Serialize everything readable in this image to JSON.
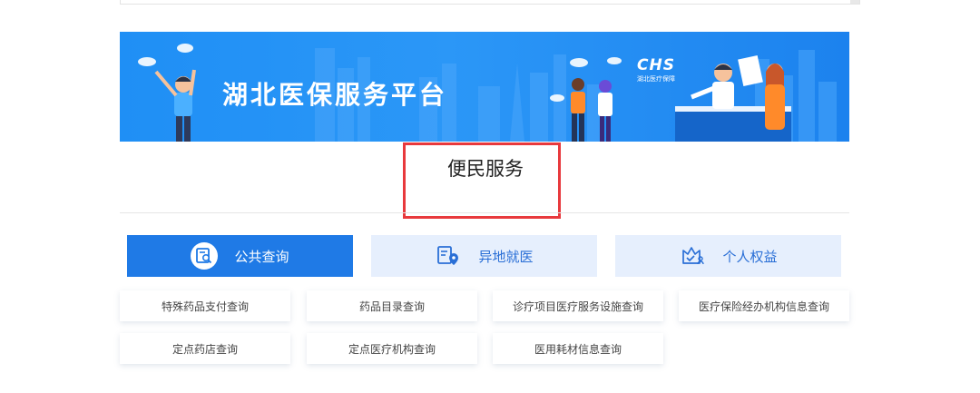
{
  "banner": {
    "title": "湖北医保服务平台",
    "logo_big": "CHS",
    "logo_small": "湖北医疗保障",
    "colors": {
      "sky": "#2a94f6",
      "building": "#5cb0ff"
    }
  },
  "section": {
    "title": "便民服务",
    "highlight_color": "#e8393d"
  },
  "tabs": [
    {
      "label": "公共查询",
      "icon": "search-document-icon",
      "active": true
    },
    {
      "label": "异地就医",
      "icon": "location-document-icon",
      "active": false
    },
    {
      "label": "个人权益",
      "icon": "crown-user-icon",
      "active": false
    }
  ],
  "services": [
    {
      "label": "特殊药品支付查询"
    },
    {
      "label": "药品目录查询"
    },
    {
      "label": "诊疗项目医疗服务设施查询"
    },
    {
      "label": "医疗保险经办机构信息查询"
    },
    {
      "label": "定点药店查询"
    },
    {
      "label": "定点医疗机构查询"
    },
    {
      "label": "医用耗材信息查询"
    }
  ],
  "colors": {
    "active_tab": "#1f7ae6",
    "inactive_tab": "#e6effd",
    "accent_text": "#2a6fd6"
  }
}
